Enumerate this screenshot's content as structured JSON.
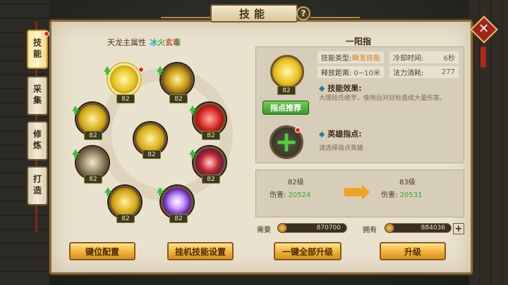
{
  "title": "技能",
  "help_label": "?",
  "close_label": "✕",
  "side_tabs": [
    {
      "label": "技能",
      "active": true,
      "badge": true
    },
    {
      "label": "采集",
      "active": false,
      "badge": false
    },
    {
      "label": "修炼",
      "active": false,
      "badge": false
    },
    {
      "label": "打造",
      "active": false,
      "badge": false
    }
  ],
  "attribute": {
    "label": "天龙主属性",
    "value": "冰火玄毒"
  },
  "skills": [
    {
      "level": "82",
      "selected": true,
      "badge": true,
      "upgradable": true,
      "icon": "golden-palm-icon"
    },
    {
      "level": "82",
      "upgradable": true,
      "icon": "golden-slash-icon"
    },
    {
      "level": "82",
      "upgradable": true,
      "icon": "golden-orb-icon"
    },
    {
      "level": "82",
      "upgradable": true,
      "icon": "red-flame-icon"
    },
    {
      "level": "82",
      "upgradable": false,
      "icon": "golden-strike-icon"
    },
    {
      "level": "82",
      "upgradable": true,
      "icon": "chain-icon"
    },
    {
      "level": "82",
      "upgradable": true,
      "icon": "crimson-burst-icon"
    },
    {
      "level": "82",
      "upgradable": true,
      "icon": "golden-fist-icon"
    },
    {
      "level": "82",
      "upgradable": true,
      "icon": "purple-sphere-icon"
    }
  ],
  "left_buttons": {
    "keybind": "键位配置",
    "auto_skill": "挂机技能设置"
  },
  "detail": {
    "skill_name": "一阳指",
    "level": "82",
    "recommend_button": "指点推荐",
    "stats": {
      "type_label": "技能类型:",
      "type_value": "瞬发技能",
      "cooldown_label": "冷却时间:",
      "cooldown_value": "6秒",
      "range_label": "释放距离:",
      "range_value": "0~10米",
      "mana_label": "法力消耗:",
      "mana_value": "277"
    },
    "effect_title": "技能效果:",
    "effect_desc": "大理段氏绝学，使用后对目标造成大量伤害。",
    "hero_title": "英雄指点:",
    "hero_desc": "请选择指点英雄"
  },
  "compare": {
    "current_level": "82级",
    "next_level": "83级",
    "damage_label": "伤害:",
    "current_damage": "20524",
    "next_damage": "20531"
  },
  "cost": {
    "need_label": "需要",
    "need_value": "870700",
    "have_label": "拥有",
    "have_value": "884036",
    "add_label": "+"
  },
  "right_buttons": {
    "upgrade_all": "一键全部升级",
    "upgrade": "升级"
  }
}
